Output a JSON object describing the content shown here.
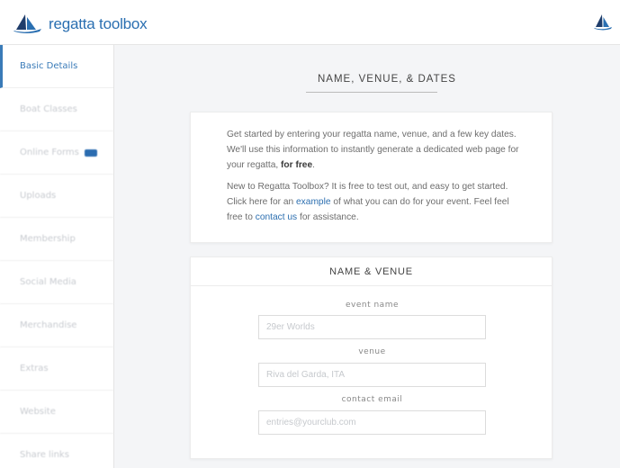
{
  "header": {
    "brand": "regatta toolbox"
  },
  "sidebar": {
    "items": [
      {
        "label": "Basic Details",
        "active": true
      },
      {
        "label": "Boat Classes"
      },
      {
        "label": "Online Forms",
        "badge": true
      },
      {
        "label": "Uploads"
      },
      {
        "label": "Membership"
      },
      {
        "label": "Social Media"
      },
      {
        "label": "Merchandise"
      },
      {
        "label": "Extras"
      },
      {
        "label": "Website"
      },
      {
        "label": "Share links"
      }
    ]
  },
  "main": {
    "section_title": "NAME, VENUE, & DATES",
    "intro": {
      "p1_text": "Get started by entering your regatta name, venue, and a few key dates. We'll use this information to instantly generate a dedicated web page for your regatta, ",
      "p1_strong": "for free",
      "p1_end": ".",
      "p2_before": "New to Regatta Toolbox? It is free to test out, and easy to get started. Click here for an ",
      "p2_link1": "example",
      "p2_mid": " of what you can do for your event. Feel feel free to ",
      "p2_link2": "contact us",
      "p2_after": " for assistance."
    },
    "form": {
      "title": "NAME & VENUE",
      "fields": [
        {
          "label": "event name",
          "placeholder": "29er Worlds"
        },
        {
          "label": "venue",
          "placeholder": "Riva del Garda, ITA"
        },
        {
          "label": "contact email",
          "placeholder": "entries@yourclub.com"
        }
      ]
    }
  },
  "colors": {
    "accent": "#2a6fb1",
    "background": "#f4f5f7"
  },
  "icons": {
    "logo": "sailboat-icon",
    "top_right": "sailboat-icon"
  }
}
